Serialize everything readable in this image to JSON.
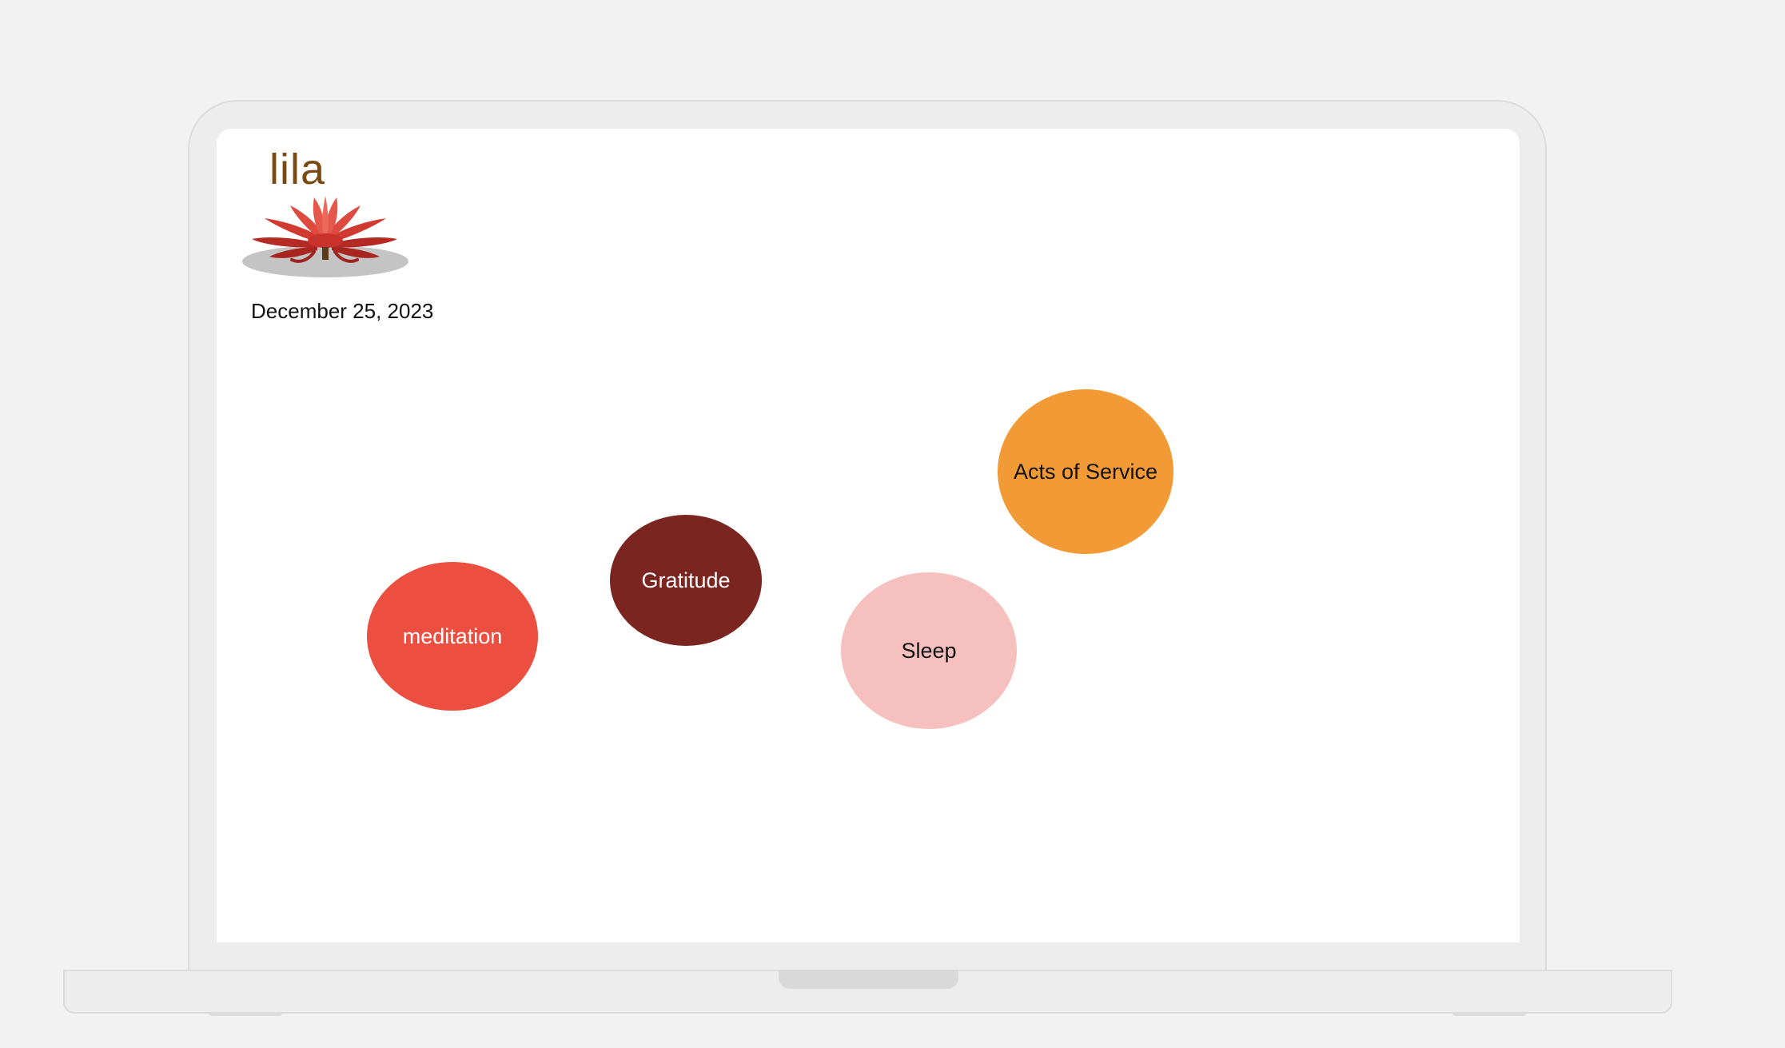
{
  "app": {
    "name": "lila"
  },
  "date": "December 25, 2023",
  "habits": [
    {
      "label": "meditation",
      "color": "#ec4f3f",
      "text_color": "#ffffff"
    },
    {
      "label": "Gratitude",
      "color": "#7a2520",
      "text_color": "#ffffff"
    },
    {
      "label": "Sleep",
      "color": "#f5c0bd",
      "text_color": "#111111"
    },
    {
      "label": "Acts of Service",
      "color": "#f29a36",
      "text_color": "#111111"
    }
  ],
  "colors": {
    "title": "#7a4a12",
    "lotus_red": "#c8322b",
    "lotus_shadow": "#c4c4c4",
    "device_frame": "#ededed",
    "page_background": "#f2f2f2"
  },
  "icons": {
    "logo": "lotus-icon"
  }
}
